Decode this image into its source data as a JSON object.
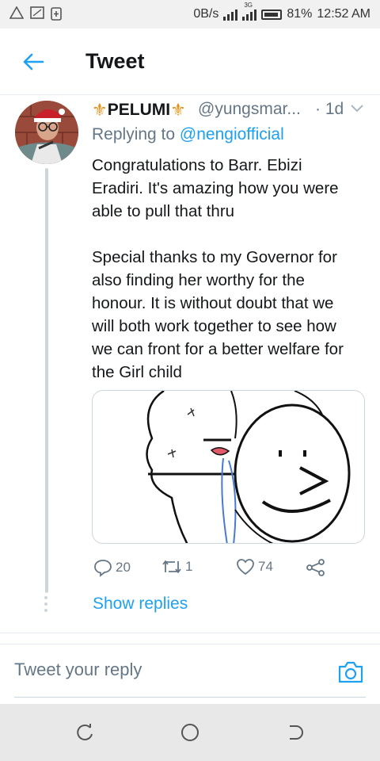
{
  "status_bar": {
    "net_speed": "0B/s",
    "network_type": "3G",
    "battery": "81%",
    "time": "12:52 AM"
  },
  "header": {
    "title": "Tweet"
  },
  "tweet": {
    "name": "PELUMI",
    "handle": "@yungsmar...",
    "time": "· 1d",
    "replying_prefix": "Replying to",
    "replying_to": "@nengiofficial",
    "text_lines": [
      "Congratulations to Barr. Ebizi",
      "Eradiri. It's amazing how you were",
      "able to pull that thru",
      "",
      "Special thanks to my Governor for",
      "also finding her worthy for the",
      "honour. It is without doubt that we",
      "will both work together to see how",
      "we can front for a better welfare for",
      "the Girl child"
    ],
    "reply_count": "20",
    "retweet_count": "1",
    "like_count": "74",
    "show_replies": "Show replies"
  },
  "reply_bar": {
    "placeholder": "Tweet your reply"
  },
  "colors": {
    "accent": "#1da1f2",
    "secondary_text": "#657786",
    "divider": "#e6ecf0",
    "fleur": "#e3941c"
  }
}
